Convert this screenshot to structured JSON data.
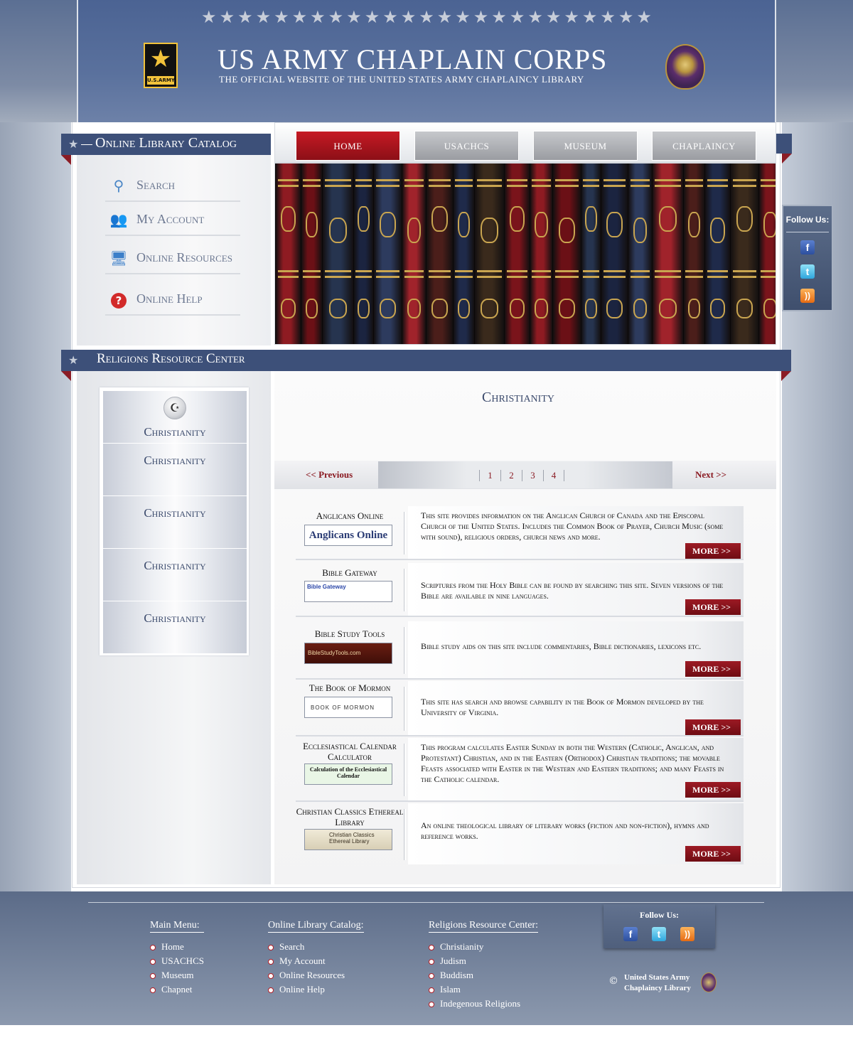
{
  "header": {
    "stars": "★★★★★★★★★★★★★★★★★★★★★★★★★",
    "army_logo_text": "U.S.ARMY",
    "title": "US ARMY CHAPLAIN CORPS",
    "subtitle": "THE OFFICIAL WEBSITE OF THE UNITED STATES ARMY CHAPLAINCY LIBRARY"
  },
  "catalog": {
    "title": "Online Library Catalog",
    "items": [
      {
        "label": "Search",
        "icon": "magnifier-icon"
      },
      {
        "label": "My Account",
        "icon": "users-icon"
      },
      {
        "label": "Online Resources",
        "icon": "computer-icon"
      },
      {
        "label": "Online Help",
        "icon": "help-icon"
      }
    ]
  },
  "nav": {
    "tabs": [
      {
        "label": "HOME",
        "active": true
      },
      {
        "label": "USACHCS",
        "active": false
      },
      {
        "label": "MUSEUM",
        "active": false
      },
      {
        "label": "CHAPLAINCY",
        "active": false
      }
    ]
  },
  "follow_side": {
    "title": "Follow Us:",
    "facebook": "f",
    "twitter": "t",
    "rss": "))"
  },
  "rrc": {
    "title": "Religions Resource Center",
    "icon_glyph": "☪",
    "items": [
      "Christianity",
      "Christianity",
      "Christianity",
      "Christianity",
      "Christianity"
    ]
  },
  "content": {
    "title": "Christianity",
    "pager": {
      "prev": "<< Previous",
      "next": "Next >>",
      "pages": [
        "1",
        "2",
        "3",
        "4"
      ]
    },
    "more_label": "MORE  >>",
    "resources": [
      {
        "name": "Anglicans Online",
        "thumb": "Anglicans Online",
        "desc": "This site provides information on the Anglican Church of Canada and the Episcopal Church of the United States. Includes the Common Book of Prayer, Church Music (some with sound), religious orders, church news and more."
      },
      {
        "name": "Bible Gateway",
        "thumb": "Bible Gateway",
        "desc": "Scriptures from the Holy Bible can be found by searching this site. Seven versions of the Bible are available in nine languages."
      },
      {
        "name": "Bible Study Tools",
        "thumb": "BibleStudyTools.com",
        "desc": "Bible study aids on this site include commentaries, Bible dictionaries, lexicons etc."
      },
      {
        "name": "The Book of Mormon",
        "thumb": "BOOK OF MORMON",
        "desc": "This site has search and browse capability in the Book of Mormon developed by the University of Virginia."
      },
      {
        "name": "Ecclesiastical Calendar Calculator",
        "thumb": "Calculation of the Ecclesiastical Calendar",
        "desc": "This program calculates Easter Sunday in both the Western (Catholic, Anglican, and Protestant) Christian, and in the Eastern (Orthodox) Christian traditions; the movable Feasts associated with Easter in the Western and Eastern traditions; and many Feasts in the Catholic calendar."
      },
      {
        "name": "Christian Classics Ethereal Library",
        "thumb": "Christian Classics Ethereal Library",
        "desc": "An online theological library of literary works (fiction and non-fiction), hymns and reference works."
      }
    ]
  },
  "footer": {
    "main_menu": {
      "title": "Main Menu:",
      "items": [
        "Home",
        "USACHCS",
        "Museum",
        "Chapnet"
      ]
    },
    "catalog": {
      "title": "Online Library Catalog:",
      "items": [
        "Search",
        "My Account",
        "Online Resources",
        "Online Help"
      ]
    },
    "rrc": {
      "title": "Religions Resource Center:",
      "items": [
        "Christianity",
        "Judism",
        "Buddism",
        "Islam",
        "Indegenous Religions"
      ]
    },
    "follow_title": "Follow Us:",
    "copyright_symbol": "©",
    "copyright_line1": "United States Army",
    "copyright_line2": "Chaplaincy Library"
  },
  "colors": {
    "navy": "#3d5079",
    "crimson": "#8b1c25",
    "active_tab": "#c61a24"
  }
}
